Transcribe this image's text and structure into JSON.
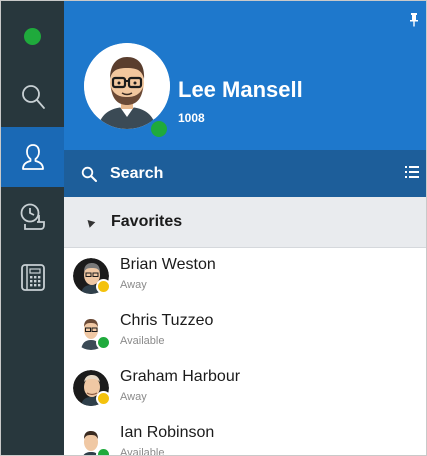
{
  "colors": {
    "rail_bg": "#28373d",
    "rail_active": "#1a69b5",
    "header_bg": "#1e78cc",
    "search_bg": "#1d5e9a",
    "available": "#1faa3c",
    "away": "#f4c20d"
  },
  "rail": {
    "status": "available",
    "items": [
      {
        "icon": "search-icon",
        "active": false
      },
      {
        "icon": "contacts-icon",
        "active": true
      },
      {
        "icon": "call-history-icon",
        "active": false
      },
      {
        "icon": "dialpad-phone-icon",
        "active": false
      }
    ]
  },
  "profile": {
    "name": "Lee Mansell",
    "extension": "1008",
    "status": "available"
  },
  "search": {
    "label": "Search"
  },
  "favorites": {
    "label": "Favorites",
    "contacts": [
      {
        "name": "Brian Weston",
        "state": "Away",
        "status": "away"
      },
      {
        "name": "Chris Tuzzeo",
        "state": "Available",
        "status": "available"
      },
      {
        "name": "Graham Harbour",
        "state": "Away",
        "status": "away"
      },
      {
        "name": "Ian Robinson",
        "state": "Available",
        "status": "available"
      }
    ]
  }
}
